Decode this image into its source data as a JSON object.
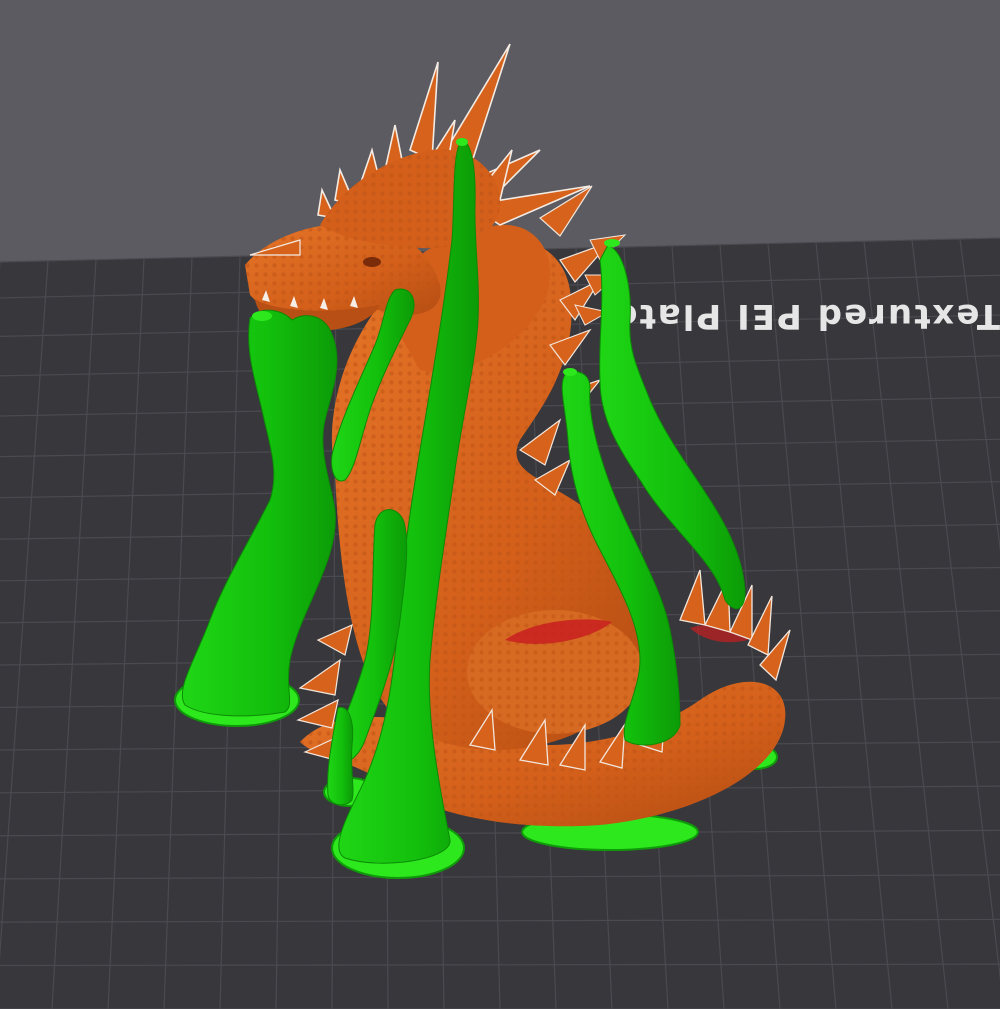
{
  "scene": {
    "plate_label": "Textured PEI Plate",
    "colors": {
      "background": "#5b5b61",
      "plate": "#37373c",
      "plate_grid": "#4a4a50",
      "model": "#d6621b",
      "model_shade": "#a84612",
      "model_highlight": "#ef8a3c",
      "support": "#17c60f",
      "support_shade": "#0f9a09",
      "support_base": "#2ee81e",
      "overhang": "#c81e1e",
      "plate_text": "#e8e8e8"
    }
  }
}
